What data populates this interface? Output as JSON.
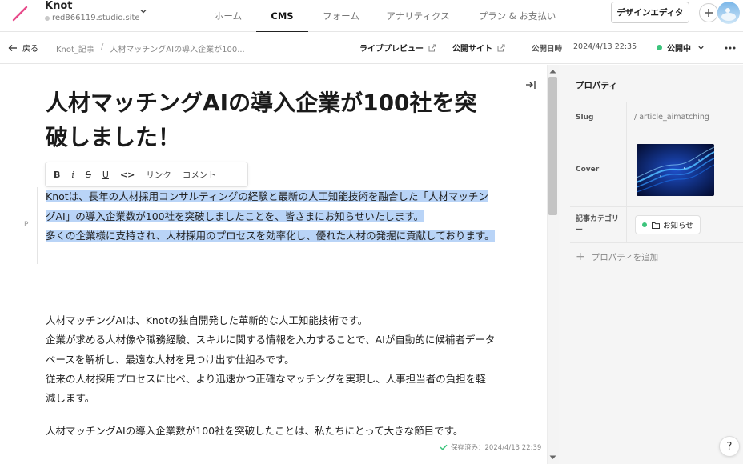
{
  "header": {
    "site_name": "Knot",
    "site_url": "red866119.studio.site",
    "nav": [
      {
        "label": "ホーム",
        "active": false
      },
      {
        "label": "CMS",
        "active": true
      },
      {
        "label": "フォーム",
        "active": false
      },
      {
        "label": "アナリティクス",
        "active": false
      },
      {
        "label": "プラン & お支払い",
        "active": false
      }
    ],
    "design_editor_label": "デザインエディタ"
  },
  "subbar": {
    "back_label": "戻る",
    "breadcrumb": [
      "Knot_記事",
      "人材マッチングAIの導入企業が100..."
    ],
    "live_preview_label": "ライブプレビュー",
    "public_site_label": "公開サイト",
    "publish_date_label": "公開日時",
    "publish_date": "2024/4/13 22:35",
    "status": "公開中"
  },
  "editor": {
    "title": "人材マッチングAIの導入企業が100社を突破しました！",
    "toolbar": {
      "bold": "B",
      "italic": "i",
      "strike": "S",
      "underline": "U",
      "code": "<>",
      "link": "リンク",
      "comment": "コメント"
    },
    "block_marker": "P",
    "selected_paragraph": [
      "Knotは、長年の人材採用コンサルティングの経験と最新の人工知能技術を融合した「人材マッチングAI」の導入企業数が100社を突破しましたことを、皆さまにお知らせいたします。",
      "多くの企業様に支持され、人材採用のプロセスを効率化し、優れた人材の発掘に貢献しております。"
    ],
    "paragraph_2": [
      "人材マッチングAIは、Knotの独自開発した革新的な人工知能技術です。",
      "企業が求める人材像や職務経験、スキルに関する情報を入力することで、AIが自動的に候補者データベースを解析し、最適な人材を見つけ出す仕組みです。",
      "従来の人材採用プロセスに比べ、より迅速かつ正確なマッチングを実現し、人事担当者の負担を軽減します。"
    ],
    "paragraph_3": "人材マッチングAIの導入企業数が100社を突破したことは、私たちにとって大きな節目です。",
    "saved_status": "保存済み：2024/4/13 22:39"
  },
  "panel": {
    "title": "プロパティ",
    "slug_label": "Slug",
    "slug_value": "/ article_aimatching",
    "cover_label": "Cover",
    "category_label": "記事カテゴリー",
    "category_value": "お知らせ",
    "add_property_label": "プロパティを追加"
  },
  "help_label": "?"
}
